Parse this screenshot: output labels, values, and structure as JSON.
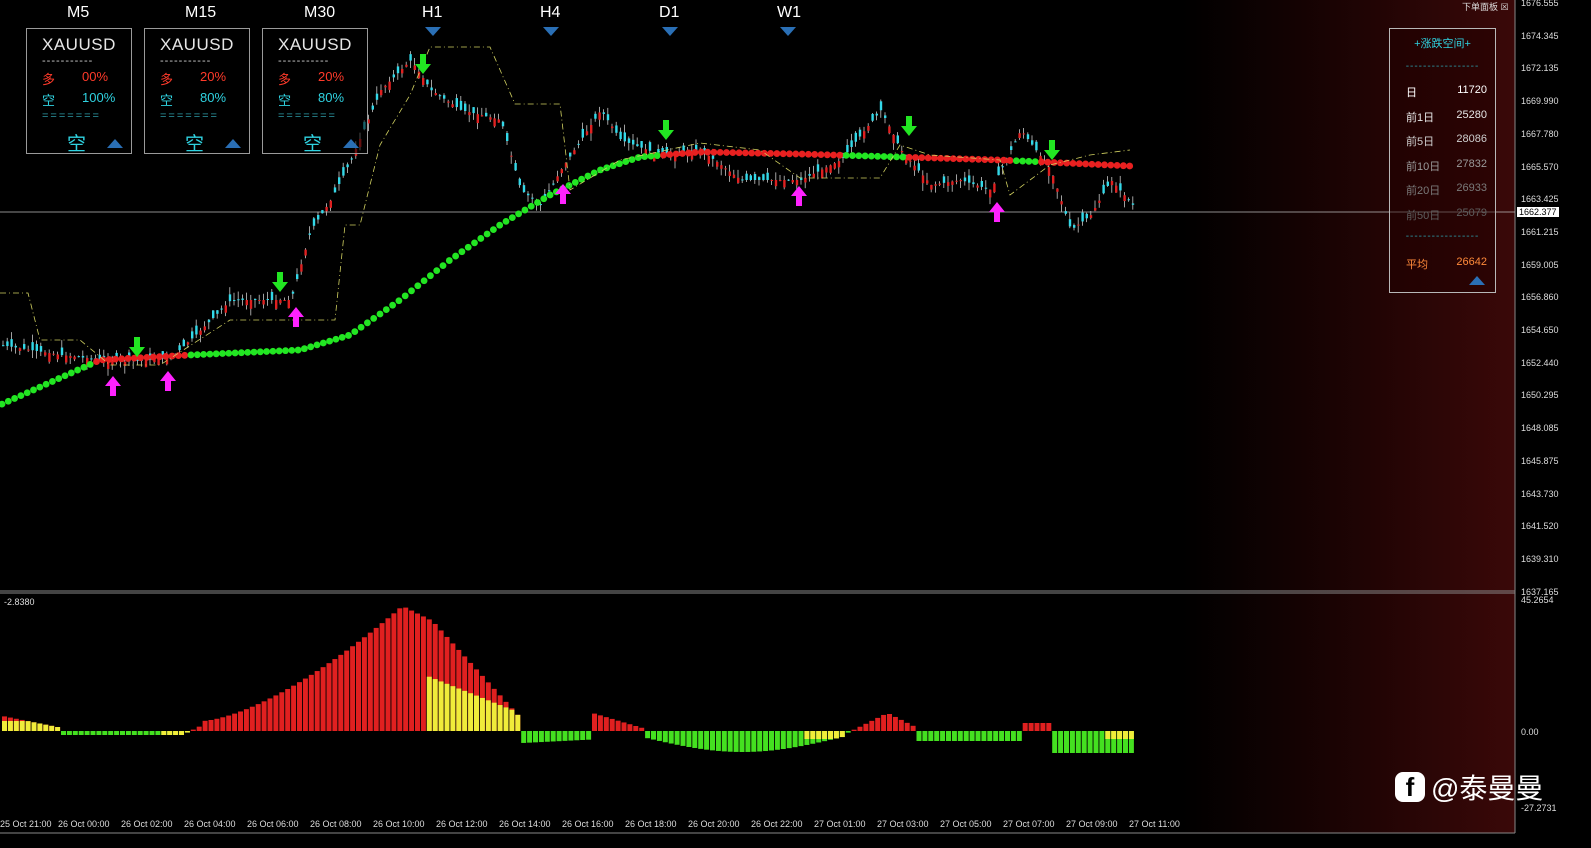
{
  "timeframes": [
    "M5",
    "M15",
    "M30",
    "H1",
    "H4",
    "D1",
    "W1"
  ],
  "boxes": [
    {
      "symbol": "XAUUSD",
      "dashes": "-----------",
      "long_label": "多",
      "long_val": "00%",
      "short_label": "空",
      "short_val": "100%",
      "eq": "=======",
      "dir": "空"
    },
    {
      "symbol": "XAUUSD",
      "dashes": "-----------",
      "long_label": "多",
      "long_val": "20%",
      "short_label": "空",
      "short_val": "80%",
      "eq": "=======",
      "dir": "空"
    },
    {
      "symbol": "XAUUSD",
      "dashes": "-----------",
      "long_label": "多",
      "long_val": "20%",
      "short_label": "空",
      "short_val": "80%",
      "eq": "=======",
      "dir": "空"
    }
  ],
  "panel": {
    "title": "+涨跌空间+",
    "dashes": "-----------------",
    "rows": [
      {
        "label": "日",
        "value": "11720",
        "color": "#ffffff"
      },
      {
        "label": "前1日",
        "value": "25280",
        "color": "#e6e6e6"
      },
      {
        "label": "前5日",
        "value": "28086",
        "color": "#cfcfcf"
      },
      {
        "label": "前10日",
        "value": "27832",
        "color": "#9a9a9a"
      },
      {
        "label": "前20日",
        "value": "26933",
        "color": "#7a7a7a"
      },
      {
        "label": "前50日",
        "value": "25079",
        "color": "#5e5e5e"
      }
    ],
    "avg_label": "平均",
    "avg_value": "26642",
    "avg_color": "#ff8a3a"
  },
  "top_right_label": "下单面板",
  "price_axis": [
    "1676.555",
    "1674.345",
    "1672.135",
    "1669.990",
    "1667.780",
    "1665.570",
    "1663.425",
    "1661.215",
    "1659.005",
    "1656.860",
    "1654.650",
    "1652.440",
    "1650.295",
    "1648.085",
    "1645.875",
    "1643.730",
    "1641.520",
    "1639.310",
    "1637.165"
  ],
  "current_price": "1662.377",
  "sub_axis": {
    "top": "45.2654",
    "zero": "0.00",
    "bottom": "-27.2731",
    "left_label": "-2.8380"
  },
  "time_axis": [
    "25 Oct 21:00",
    "26 Oct 00:00",
    "26 Oct 02:00",
    "26 Oct 04:00",
    "26 Oct 06:00",
    "26 Oct 08:00",
    "26 Oct 10:00",
    "26 Oct 12:00",
    "26 Oct 14:00",
    "26 Oct 16:00",
    "26 Oct 18:00",
    "26 Oct 20:00",
    "26 Oct 22:00",
    "27 Oct 01:00",
    "27 Oct 03:00",
    "27 Oct 05:00",
    "27 Oct 07:00",
    "27 Oct 09:00",
    "27 Oct 11:00"
  ],
  "watermark": "@泰曼曼",
  "colors": {
    "bull": "#e02020",
    "bear": "#33d8e8",
    "wick": "#c8c8c8",
    "dot_up": "#22e622",
    "dot_down": "#e82020",
    "arrow_up": "#ff22ff",
    "arrow_down": "#22e622",
    "hist_red": "#e02020",
    "hist_yellow": "#f0ec3a",
    "hist_green": "#44e020"
  }
}
